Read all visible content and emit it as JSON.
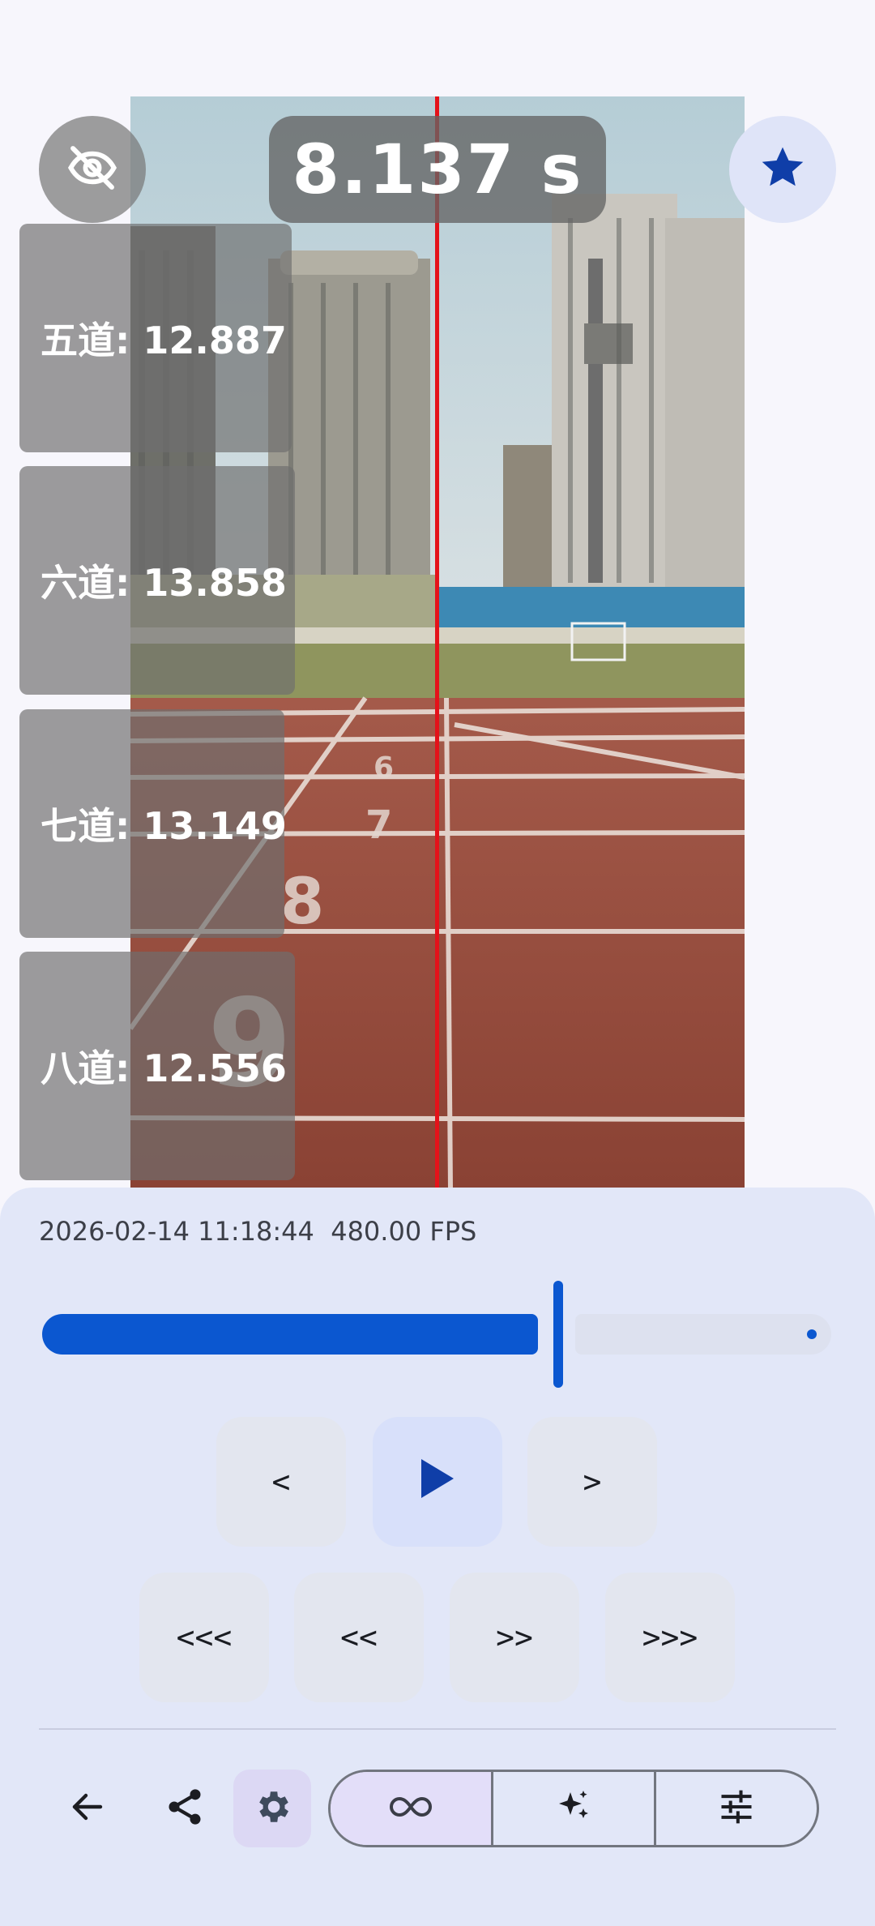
{
  "overlay": {
    "timer_text": "8.137 s",
    "hide_icon": "eye-off-icon",
    "star_icon": "star-icon"
  },
  "lanes": [
    {
      "label": "五道: 12.887"
    },
    {
      "label": "六道: 13.858"
    },
    {
      "label": "七道: 13.149"
    },
    {
      "label": "八道: 12.556"
    }
  ],
  "info": {
    "datetime": "2026-02-14 11:18:44",
    "fps": "480.00 FPS"
  },
  "scrubber": {
    "progress": 0.59
  },
  "controls": {
    "prev_frame": "<",
    "next_frame": ">",
    "play_icon": "play-icon",
    "skip_back_large": "<<<",
    "skip_back": "<<",
    "skip_forward": ">>",
    "skip_forward_large": ">>>"
  },
  "toolbar": {
    "back_icon": "arrow-left-icon",
    "share_icon": "share-icon",
    "settings_icon": "gear-icon",
    "segments": [
      "infinity-icon",
      "sparkle-icon",
      "tune-icon"
    ]
  },
  "colors": {
    "accent": "#0b57d0",
    "finish_line": "#e4121a",
    "track": "#9a4a3c"
  }
}
